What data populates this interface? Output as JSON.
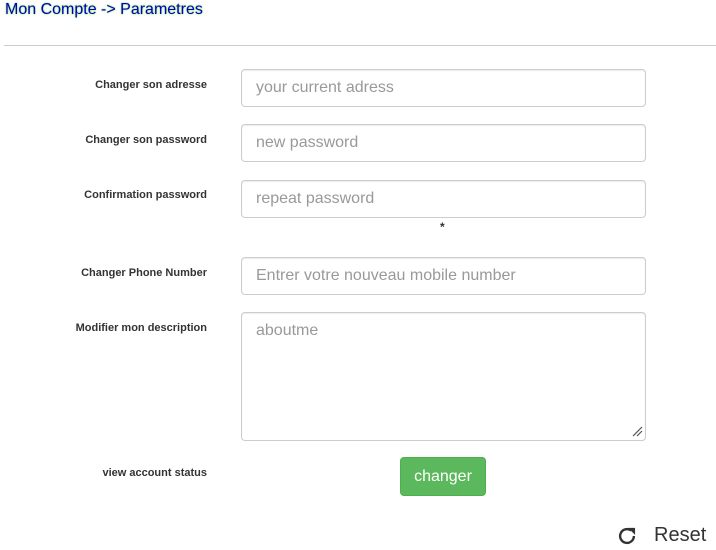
{
  "breadcrumb": "Mon Compte -> Parametres",
  "form": {
    "address": {
      "label": "Changer son adresse",
      "placeholder": "your current adress",
      "value": ""
    },
    "password": {
      "label": "Changer son password",
      "placeholder": "new password",
      "value": ""
    },
    "confirm": {
      "label": "Confirmation password",
      "placeholder": "repeat password",
      "value": "",
      "note": "*"
    },
    "phone": {
      "label": "Changer Phone Number",
      "placeholder": "Entrer votre nouveau mobile number",
      "value": ""
    },
    "description": {
      "label": "Modifier mon description",
      "placeholder": "aboutme",
      "value": ""
    },
    "status": {
      "label": "view account status"
    },
    "submit_label": "changer"
  },
  "reset": {
    "label": "Reset",
    "icon": "refresh-icon"
  },
  "colors": {
    "breadcrumb_text": "#0000cc",
    "breadcrumb_glow": "#7fdc3a",
    "submit_bg": "#5cb85c",
    "submit_border": "#4cae4c"
  }
}
